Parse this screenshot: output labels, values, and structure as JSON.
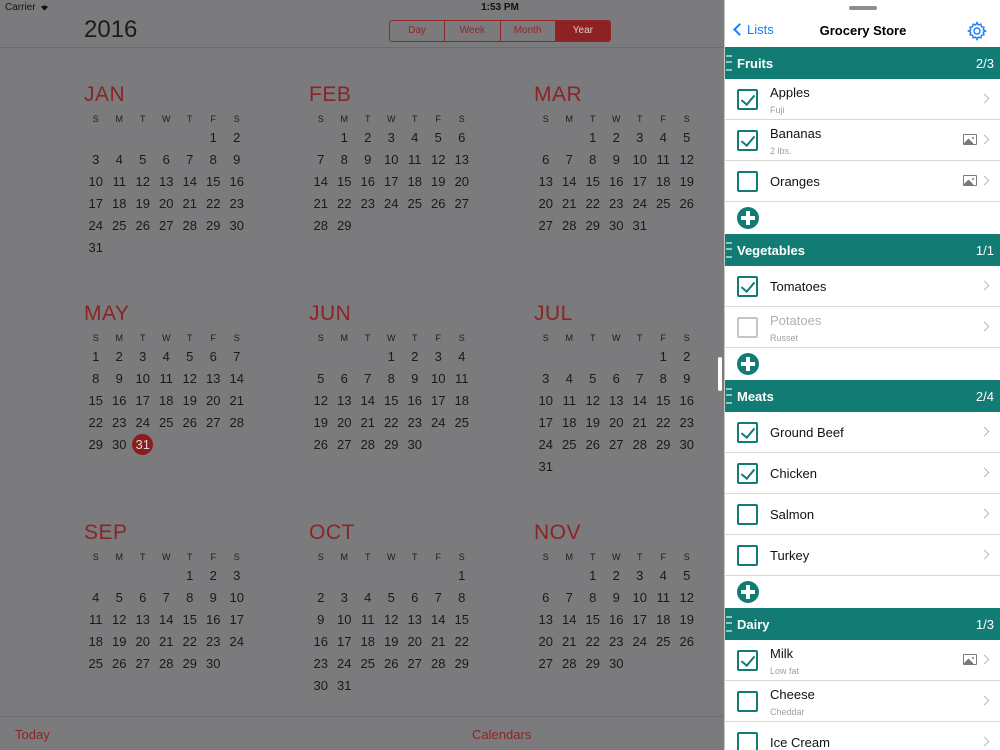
{
  "status_bar": {
    "carrier": "Carrier",
    "time": "1:53 PM"
  },
  "calendar": {
    "year": "2016",
    "views": [
      "Day",
      "Week",
      "Month",
      "Year"
    ],
    "active_view": "Year",
    "dow": [
      "S",
      "M",
      "T",
      "W",
      "T",
      "F",
      "S"
    ],
    "months": [
      {
        "name": "JAN",
        "offset": 5,
        "days": 31
      },
      {
        "name": "FEB",
        "offset": 1,
        "days": 29
      },
      {
        "name": "MAR",
        "offset": 2,
        "days": 31
      },
      {
        "name": "MAY",
        "offset": 0,
        "days": 31,
        "today": 31
      },
      {
        "name": "JUN",
        "offset": 3,
        "days": 30
      },
      {
        "name": "JUL",
        "offset": 5,
        "days": 31
      },
      {
        "name": "SEP",
        "offset": 4,
        "days": 30
      },
      {
        "name": "OCT",
        "offset": 6,
        "days": 31
      },
      {
        "name": "NOV",
        "offset": 2,
        "days": 30
      }
    ],
    "today_label": "Today",
    "calendars_label": "Calendars"
  },
  "panel": {
    "back_label": "Lists",
    "title": "Grocery Store",
    "sections": [
      {
        "name": "Fruits",
        "count": "2/3",
        "items": [
          {
            "title": "Apples",
            "subtitle": "Fuji",
            "checked": true,
            "image": false
          },
          {
            "title": "Bananas",
            "subtitle": "2 lbs.",
            "checked": true,
            "image": true
          },
          {
            "title": "Oranges",
            "subtitle": "",
            "checked": false,
            "image": true
          }
        ]
      },
      {
        "name": "Vegetables",
        "count": "1/1",
        "items": [
          {
            "title": "Tomatoes",
            "subtitle": "",
            "checked": true,
            "image": false
          },
          {
            "title": "Potatoes",
            "subtitle": "Russet",
            "checked": false,
            "image": false,
            "disabled": true
          }
        ]
      },
      {
        "name": "Meats",
        "count": "2/4",
        "items": [
          {
            "title": "Ground Beef",
            "subtitle": "",
            "checked": true,
            "image": false
          },
          {
            "title": "Chicken",
            "subtitle": "",
            "checked": true,
            "image": false
          },
          {
            "title": "Salmon",
            "subtitle": "",
            "checked": false,
            "image": false
          },
          {
            "title": "Turkey",
            "subtitle": "",
            "checked": false,
            "image": false
          }
        ]
      },
      {
        "name": "Dairy",
        "count": "1/3",
        "items": [
          {
            "title": "Milk",
            "subtitle": "Low fat",
            "checked": true,
            "image": true
          },
          {
            "title": "Cheese",
            "subtitle": "Cheddar",
            "checked": false,
            "image": false
          },
          {
            "title": "Ice Cream",
            "subtitle": "",
            "checked": false,
            "image": false
          }
        ]
      }
    ]
  }
}
